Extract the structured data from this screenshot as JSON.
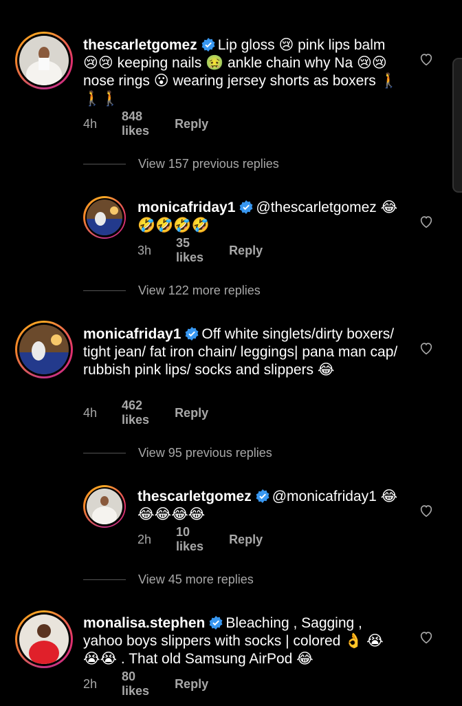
{
  "comments": [
    {
      "username": "thescarletgomez",
      "text": "Lip gloss 😢 pink lips balm 😢😢 keeping nails 🤢 ankle chain why Na 😢😢 nose rings 😮 wearing jersey shorts as boxers 🚶🚶🚶",
      "time": "4h",
      "likes": "848 likes",
      "reply": "Reply"
    },
    {
      "username": "monicafriday1",
      "text": "@thescarletgomez 😂🤣🤣🤣🤣",
      "time": "3h",
      "likes": "35 likes",
      "reply": "Reply"
    },
    {
      "username": "monicafriday1",
      "text": "Off white singlets/dirty boxers/ tight jean/ fat iron chain/ leggings| pana man cap/ rubbish pink lips/ socks and slippers 😂",
      "time": "4h",
      "likes": "462 likes",
      "reply": "Reply"
    },
    {
      "username": "thescarletgomez",
      "text": "@monicafriday1 😂😂😂😂😂",
      "time": "2h",
      "likes": "10 likes",
      "reply": "Reply"
    },
    {
      "username": "monalisa.stephen",
      "text": "Bleaching , Sagging , yahoo boys slippers with socks | colored 👌 😭😭😭 . That old Samsung AirPod 😂",
      "time": "2h",
      "likes": "80 likes",
      "reply": "Reply"
    }
  ],
  "toggles": [
    "View 157 previous replies",
    "View 122 more replies",
    "View 95 previous replies",
    "View 45 more replies"
  ],
  "colors": {
    "background": "#000000",
    "secondary_text": "#a8a8a8",
    "verified_blue": "#3897f0"
  },
  "icons": {
    "verified": "verified-badge-icon",
    "like": "heart-outline-icon"
  }
}
